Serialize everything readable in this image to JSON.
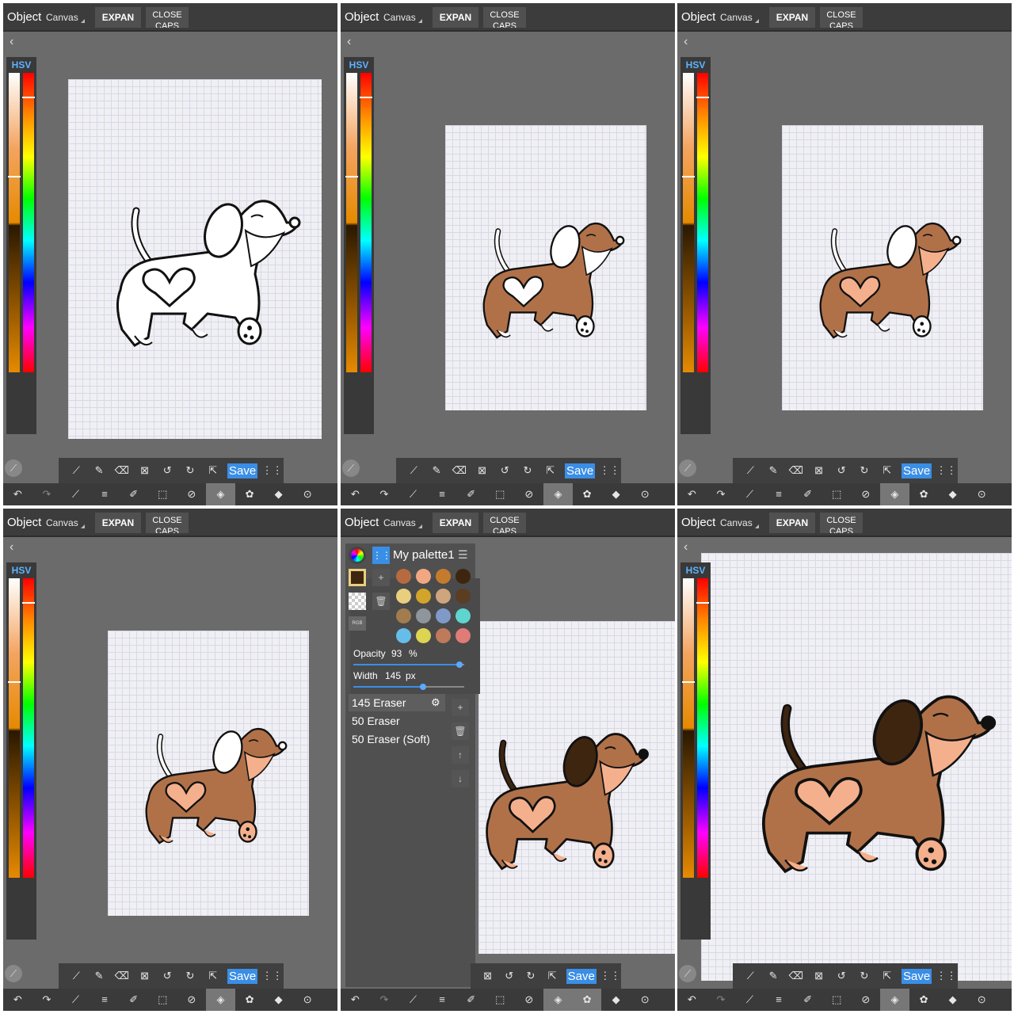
{
  "app": {
    "object_label": "Object",
    "canvas_label": "Canvas",
    "expand_label": "EXPAN",
    "close_label": "CLOSE CAPS",
    "back_glyph": "‹",
    "hsv_label": "HSV",
    "save_label": "Save"
  },
  "palette": {
    "name": "My palette1",
    "rgb_label": "RGB",
    "opacity_label": "Opacity",
    "opacity_value": "93",
    "opacity_unit": "%",
    "opacity_fraction": 0.93,
    "width_label": "Width",
    "width_value": "145",
    "width_unit": "px",
    "brushes": [
      "145 Eraser",
      "50 Eraser",
      "50 Eraser (Soft)"
    ],
    "swatches": [
      "#b66a3f",
      "#f1a882",
      "#c47b2e",
      "#3e2510",
      "#e8cf7e",
      "#d3a42a",
      "#cfa57e",
      "#5b3d22",
      "#a27c4f",
      "#8e959c",
      "#7f9ac9",
      "#5fd5cf",
      "#66bde9",
      "#ddd451",
      "#bf7a5b",
      "#e07b77"
    ]
  },
  "colors": {
    "accent": "#3a8ee6",
    "body": "#b07149",
    "light": "#f4b08c",
    "dark_ear": "#3e2510"
  },
  "icons": {
    "toolbar": [
      "eyedropper-icon",
      "pen-icon",
      "eraser-icon",
      "transform-icon",
      "rotate-left-icon",
      "rotate-right-icon",
      "export-icon",
      "save-button",
      "grid-icon"
    ],
    "bottombar": [
      "undo-icon",
      "redo-icon",
      "eyedropper-icon",
      "menu-icon",
      "edit-icon",
      "selection-icon",
      "no-fill-icon",
      "bucket-icon",
      "palette-icon",
      "layers-icon",
      "more-icon"
    ]
  }
}
